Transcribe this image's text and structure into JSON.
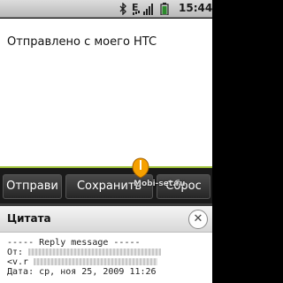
{
  "statusbar": {
    "network_letter": "E",
    "time": "15:44",
    "icons": [
      "bluetooth-icon",
      "edge-data-icon",
      "signal-icon",
      "battery-icon"
    ]
  },
  "compose": {
    "body_text": "Отправлено с моего HTC"
  },
  "buttons": {
    "send": "Отправи",
    "save": "Сохранить",
    "reset": "Сброс"
  },
  "watermark": "Mobi-set.ru",
  "quote": {
    "title": "Цитата",
    "close_icon": "close-icon",
    "header_line": "----- Reply message -----",
    "from_label": "От:",
    "from_second": "<v.r",
    "date_line": "Дата: ср, ноя 25, 2009 11:26"
  },
  "colors": {
    "accent": "#9fc23a",
    "cursor": "#f5a000"
  }
}
